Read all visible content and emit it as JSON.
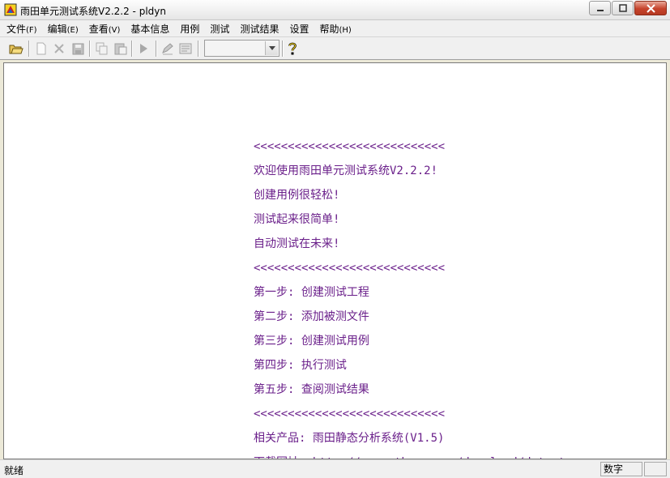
{
  "window": {
    "title": "雨田单元测试系统V2.2.2 - pldyn",
    "minimize_icon": "minimize-icon",
    "maximize_icon": "maximize-icon",
    "close_icon": "close-icon"
  },
  "menu": [
    {
      "label": "文件",
      "mnemonic": "(F)"
    },
    {
      "label": "编辑",
      "mnemonic": "(E)"
    },
    {
      "label": "查看",
      "mnemonic": "(V)"
    },
    {
      "label": "基本信息",
      "mnemonic": ""
    },
    {
      "label": "用例",
      "mnemonic": ""
    },
    {
      "label": "测试",
      "mnemonic": ""
    },
    {
      "label": "测试结果",
      "mnemonic": ""
    },
    {
      "label": "设置",
      "mnemonic": ""
    },
    {
      "label": "帮助",
      "mnemonic": "(H)"
    }
  ],
  "toolbar": {
    "buttons": [
      "open-folder-icon",
      "new-file-icon",
      "delete-icon",
      "save-icon",
      "copy-icon",
      "paste-icon",
      "run-icon",
      "edit-icon",
      "report-icon"
    ],
    "combo_value": "",
    "help_icon": "help-icon"
  },
  "content": {
    "lines": [
      "<<<<<<<<<<<<<<<<<<<<<<<<<<<<",
      "欢迎使用雨田单元测试系统V2.2.2!",
      "创建用例很轻松!",
      "测试起来很简单!",
      "自动测试在未来!",
      "<<<<<<<<<<<<<<<<<<<<<<<<<<<<",
      "第一步: 创建测试工程",
      "第二步: 添加被测文件",
      "第三步: 创建测试用例",
      "第四步: 执行测试",
      "第五步: 查阅测试结果",
      "<<<<<<<<<<<<<<<<<<<<<<<<<<<<",
      "相关产品: 雨田静态分析系统(V1.5)",
      "下载网址: http://www.rtboss.com/download/detect"
    ],
    "text_color": "#6a1f8a"
  },
  "status": {
    "left": "就绪",
    "mode": "数字"
  }
}
